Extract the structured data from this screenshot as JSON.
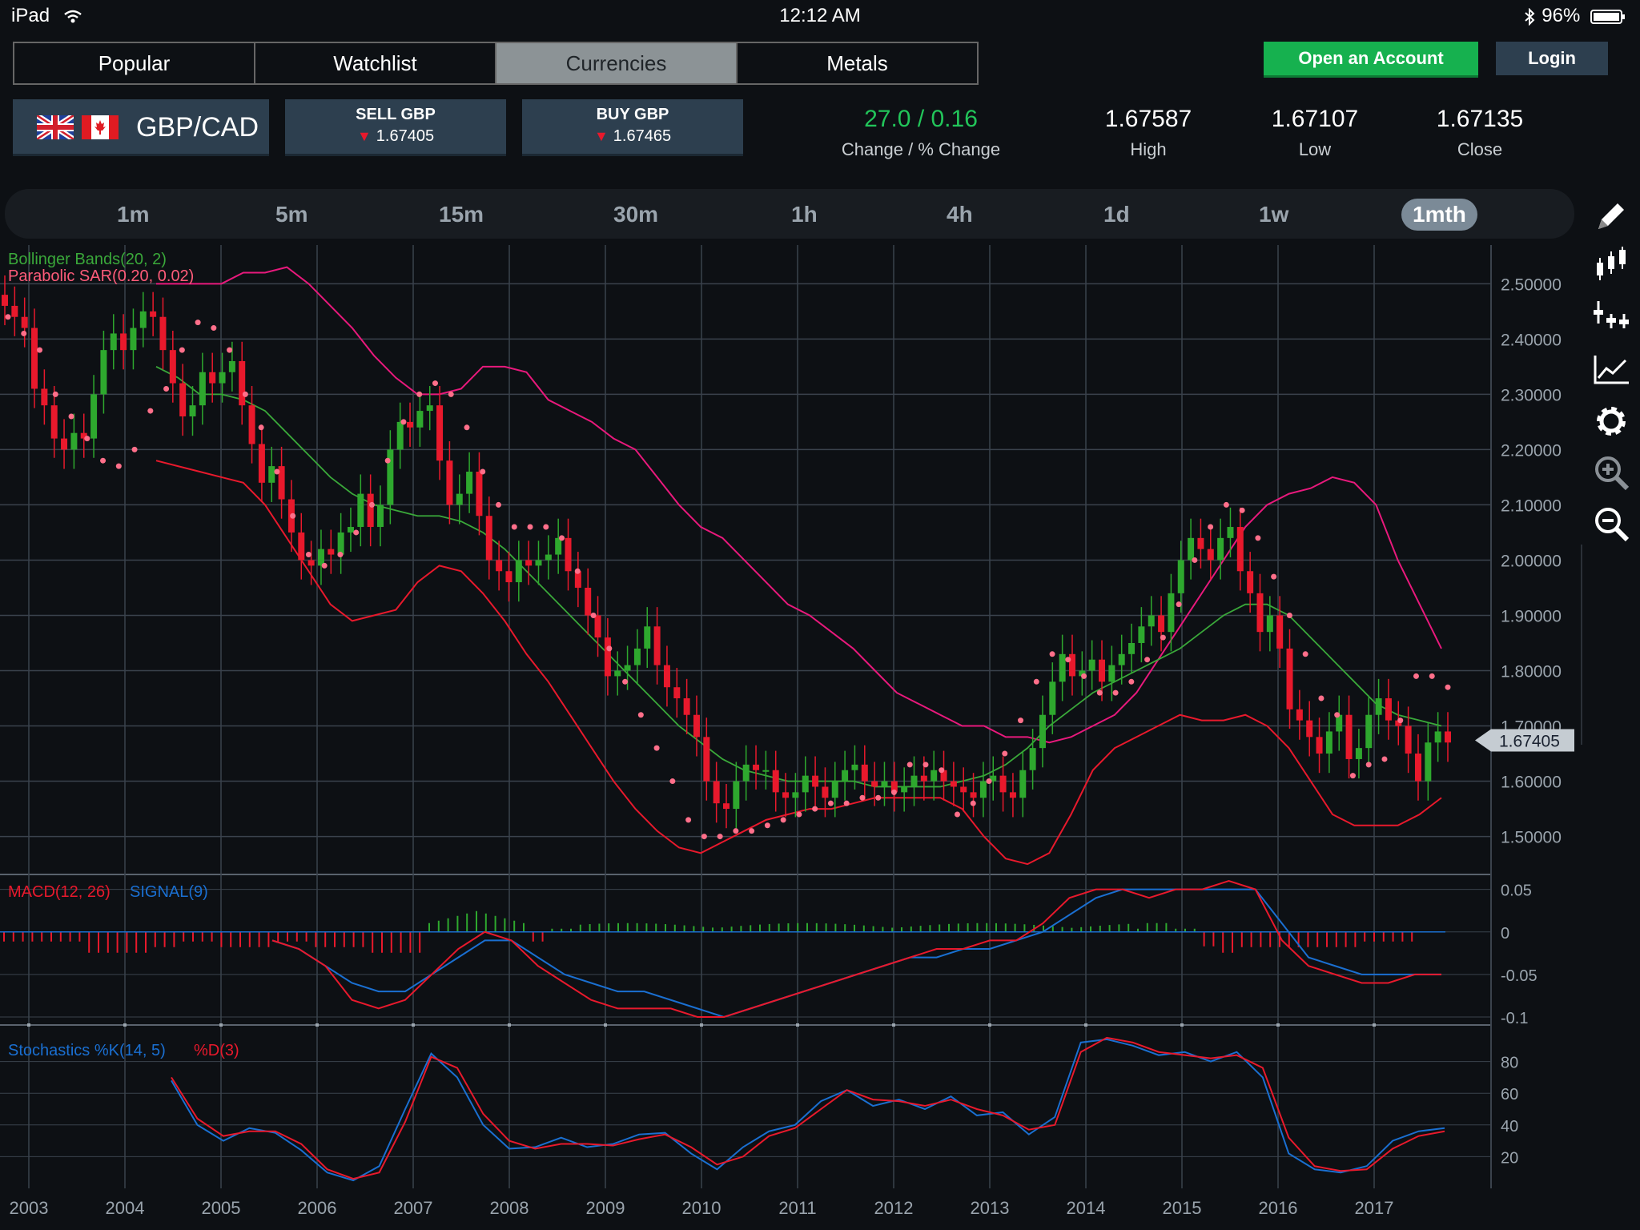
{
  "status_bar": {
    "device": "iPad",
    "time": "12:12 AM",
    "battery": "96%"
  },
  "tabs": [
    {
      "label": "Popular",
      "active": false
    },
    {
      "label": "Watchlist",
      "active": false
    },
    {
      "label": "Currencies",
      "active": true
    },
    {
      "label": "Metals",
      "active": false
    }
  ],
  "buttons": {
    "open_account": "Open an Account",
    "login": "Login"
  },
  "instrument": {
    "pair": "GBP/CAD",
    "flags": [
      "uk-flag-icon",
      "canada-flag-icon"
    ],
    "sell_label": "SELL GBP",
    "sell_price": "1.67405",
    "buy_label": "BUY GBP",
    "buy_price": "1.67465"
  },
  "stats": {
    "change_value": "27.0 / 0.16",
    "change_label": "Change / % Change",
    "high_value": "1.67587",
    "high_label": "High",
    "low_value": "1.67107",
    "low_label": "Low",
    "close_value": "1.67135",
    "close_label": "Close"
  },
  "timeframes": [
    "1m",
    "5m",
    "15m",
    "30m",
    "1h",
    "4h",
    "1d",
    "1w",
    "1mth"
  ],
  "active_timeframe": "1mth",
  "side_tools": [
    "pencil-icon",
    "candlestick-icon",
    "add-indicator-icon",
    "line-chart-icon",
    "gear-icon",
    "zoom-in-icon",
    "zoom-out-icon"
  ],
  "colors": {
    "up": "#2ea82e",
    "down": "#e8192c",
    "bollinger_upper": "#e8197c",
    "bollinger_mid": "#3aa83a",
    "bollinger_lower": "#e8192c",
    "sar": "#ff6f8a",
    "macd": "#e8192c",
    "signal": "#1a6fd1",
    "stoch_k": "#1a6fd1",
    "stoch_d": "#e8192c",
    "grid": "#3a424c",
    "price_tag": "#c5ccd2"
  },
  "chart_data": [
    {
      "type": "candlestick",
      "title": "",
      "indicators": [
        "Bollinger Bands(20, 2)",
        "Parabolic SAR(0.20, 0.02)"
      ],
      "x": [
        "2003",
        "2004",
        "2005",
        "2006",
        "2007",
        "2008",
        "2009",
        "2010",
        "2011",
        "2012",
        "2013",
        "2014",
        "2015",
        "2016",
        "2017"
      ],
      "y_ticks": [
        "2.50000",
        "2.40000",
        "2.30000",
        "2.20000",
        "2.10000",
        "2.00000",
        "1.90000",
        "1.80000",
        "1.70000",
        "1.60000",
        "1.50000"
      ],
      "ylim": [
        1.44,
        2.57
      ],
      "last_price": "1.67405",
      "close": [
        2.46,
        2.44,
        2.42,
        2.31,
        2.28,
        2.22,
        2.2,
        2.23,
        2.22,
        2.3,
        2.38,
        2.41,
        2.38,
        2.42,
        2.45,
        2.44,
        2.38,
        2.32,
        2.26,
        2.28,
        2.34,
        2.32,
        2.34,
        2.36,
        2.28,
        2.21,
        2.14,
        2.17,
        2.11,
        2.05,
        2.0,
        1.99,
        2.02,
        2.01,
        2.05,
        2.06,
        2.12,
        2.06,
        2.1,
        2.2,
        2.25,
        2.24,
        2.27,
        2.28,
        2.18,
        2.1,
        2.12,
        2.16,
        2.08,
        2.0,
        1.98,
        1.96,
        2.0,
        1.99,
        2.0,
        2.01,
        2.04,
        1.98,
        1.95,
        1.9,
        1.86,
        1.79,
        1.8,
        1.81,
        1.84,
        1.88,
        1.81,
        1.77,
        1.75,
        1.72,
        1.68,
        1.6,
        1.56,
        1.55,
        1.6,
        1.63,
        1.62,
        1.62,
        1.58,
        1.57,
        1.58,
        1.61,
        1.59,
        1.57,
        1.6,
        1.62,
        1.63,
        1.6,
        1.59,
        1.6,
        1.58,
        1.59,
        1.61,
        1.6,
        1.62,
        1.6,
        1.59,
        1.58,
        1.57,
        1.6,
        1.61,
        1.58,
        1.57,
        1.62,
        1.66,
        1.72,
        1.78,
        1.83,
        1.79,
        1.8,
        1.82,
        1.78,
        1.81,
        1.83,
        1.85,
        1.88,
        1.9,
        1.87,
        1.94,
        2.0,
        2.04,
        2.02,
        2.0,
        2.04,
        2.06,
        1.98,
        1.94,
        1.87,
        1.9,
        1.84,
        1.73,
        1.71,
        1.68,
        1.65,
        1.69,
        1.72,
        1.64,
        1.66,
        1.72,
        1.75,
        1.71,
        1.7,
        1.65,
        1.6,
        1.67,
        1.69,
        1.67
      ],
      "bollinger_upper": [
        2.5,
        2.5,
        2.5,
        2.5,
        2.52,
        2.52,
        2.53,
        2.5,
        2.46,
        2.42,
        2.37,
        2.33,
        2.3,
        2.3,
        2.31,
        2.35,
        2.35,
        2.34,
        2.29,
        2.27,
        2.25,
        2.22,
        2.2,
        2.15,
        2.1,
        2.06,
        2.04,
        2.0,
        1.96,
        1.92,
        1.9,
        1.87,
        1.84,
        1.8,
        1.76,
        1.74,
        1.72,
        1.7,
        1.7,
        1.68,
        1.68,
        1.67,
        1.68,
        1.7,
        1.72,
        1.76,
        1.82,
        1.88,
        1.94,
        2.0,
        2.06,
        2.1,
        2.12,
        2.13,
        2.15,
        2.14,
        2.1,
        2.0,
        1.92,
        1.84
      ],
      "bollinger_mid": [
        2.35,
        2.33,
        2.3,
        2.3,
        2.29,
        2.27,
        2.23,
        2.19,
        2.15,
        2.12,
        2.1,
        2.09,
        2.08,
        2.08,
        2.07,
        2.05,
        2.02,
        1.98,
        1.94,
        1.9,
        1.86,
        1.82,
        1.78,
        1.74,
        1.7,
        1.67,
        1.64,
        1.62,
        1.61,
        1.6,
        1.6,
        1.6,
        1.6,
        1.59,
        1.59,
        1.59,
        1.59,
        1.6,
        1.61,
        1.63,
        1.66,
        1.7,
        1.73,
        1.76,
        1.78,
        1.8,
        1.82,
        1.84,
        1.87,
        1.9,
        1.92,
        1.92,
        1.9,
        1.86,
        1.82,
        1.78,
        1.74,
        1.72,
        1.71,
        1.7
      ],
      "bollinger_lower": [
        2.18,
        2.17,
        2.16,
        2.15,
        2.14,
        2.1,
        2.04,
        1.98,
        1.92,
        1.89,
        1.9,
        1.91,
        1.96,
        1.99,
        1.98,
        1.94,
        1.89,
        1.83,
        1.78,
        1.72,
        1.66,
        1.6,
        1.55,
        1.51,
        1.48,
        1.47,
        1.49,
        1.51,
        1.53,
        1.54,
        1.55,
        1.55,
        1.56,
        1.57,
        1.57,
        1.57,
        1.57,
        1.55,
        1.5,
        1.46,
        1.45,
        1.47,
        1.54,
        1.62,
        1.66,
        1.68,
        1.7,
        1.72,
        1.71,
        1.71,
        1.72,
        1.7,
        1.66,
        1.6,
        1.54,
        1.52,
        1.52,
        1.52,
        1.54,
        1.57
      ],
      "sar": [
        2.44,
        2.41,
        2.38,
        2.3,
        2.26,
        2.22,
        2.18,
        2.17,
        2.2,
        2.27,
        2.31,
        2.38,
        2.43,
        2.42,
        2.38,
        2.3,
        2.24,
        2.16,
        2.08,
        2.01,
        1.99,
        2.01,
        2.05,
        2.1,
        2.18,
        2.25,
        2.3,
        2.32,
        2.3,
        2.24,
        2.16,
        2.1,
        2.06,
        2.06,
        2.06,
        2.04,
        1.98,
        1.9,
        1.84,
        1.78,
        1.72,
        1.66,
        1.6,
        1.53,
        1.5,
        1.5,
        1.51,
        1.51,
        1.52,
        1.53,
        1.54,
        1.55,
        1.56,
        1.56,
        1.57,
        1.57,
        1.58,
        1.63,
        1.63,
        1.62,
        1.54,
        1.56,
        1.6,
        1.65,
        1.71,
        1.78,
        1.83,
        1.82,
        1.79,
        1.76,
        1.76,
        1.78,
        1.82,
        1.86,
        1.92,
        2.0,
        2.06,
        2.1,
        2.09,
        2.04,
        1.97,
        1.9,
        1.83,
        1.75,
        1.72,
        1.61,
        1.63,
        1.64,
        1.71,
        1.79,
        1.79,
        1.77
      ]
    },
    {
      "type": "line",
      "title": "MACD(12, 26) SIGNAL(9)",
      "series": [
        {
          "name": "MACD(12, 26)"
        },
        {
          "name": "SIGNAL(9)"
        }
      ],
      "y_ticks": [
        "0.05",
        "0",
        "-0.05",
        "-0.1"
      ],
      "ylim": [
        -0.1,
        0.06
      ],
      "macd": [
        -0.01,
        -0.02,
        -0.04,
        -0.08,
        -0.09,
        -0.08,
        -0.05,
        -0.02,
        0.0,
        -0.01,
        -0.04,
        -0.06,
        -0.08,
        -0.09,
        -0.09,
        -0.09,
        -0.1,
        -0.1,
        -0.09,
        -0.08,
        -0.07,
        -0.06,
        -0.05,
        -0.04,
        -0.03,
        -0.02,
        -0.02,
        -0.01,
        -0.01,
        0.01,
        0.04,
        0.05,
        0.05,
        0.04,
        0.05,
        0.05,
        0.06,
        0.05,
        -0.01,
        -0.04,
        -0.05,
        -0.06,
        -0.06,
        -0.05,
        -0.05
      ],
      "signal": [
        -0.01,
        -0.02,
        -0.04,
        -0.06,
        -0.07,
        -0.07,
        -0.05,
        -0.03,
        -0.01,
        -0.01,
        -0.03,
        -0.05,
        -0.06,
        -0.07,
        -0.07,
        -0.08,
        -0.09,
        -0.1,
        -0.09,
        -0.08,
        -0.07,
        -0.06,
        -0.05,
        -0.04,
        -0.03,
        -0.03,
        -0.02,
        -0.02,
        -0.01,
        0.0,
        0.02,
        0.04,
        0.05,
        0.05,
        0.05,
        0.05,
        0.05,
        0.05,
        0.01,
        -0.03,
        -0.04,
        -0.05,
        -0.05,
        -0.05,
        -0.05
      ]
    },
    {
      "type": "line",
      "title": "Stochastics %K(14, 5) %D(3)",
      "series": [
        {
          "name": "%K(14, 5)"
        },
        {
          "name": "%D(3)"
        }
      ],
      "y_ticks": [
        "80",
        "60",
        "40",
        "20"
      ],
      "ylim": [
        0,
        100
      ],
      "k": [
        68,
        40,
        30,
        38,
        35,
        24,
        10,
        5,
        14,
        50,
        85,
        70,
        40,
        25,
        26,
        32,
        26,
        28,
        34,
        35,
        22,
        12,
        26,
        36,
        40,
        55,
        62,
        52,
        56,
        50,
        58,
        46,
        48,
        34,
        45,
        92,
        94,
        90,
        84,
        86,
        80,
        86,
        70,
        22,
        12,
        10,
        14,
        30,
        36,
        38
      ],
      "d": [
        70,
        44,
        33,
        36,
        36,
        28,
        12,
        6,
        10,
        42,
        83,
        76,
        47,
        30,
        25,
        28,
        28,
        27,
        31,
        34,
        26,
        15,
        20,
        33,
        38,
        50,
        62,
        56,
        55,
        52,
        56,
        50,
        46,
        37,
        40,
        86,
        95,
        92,
        86,
        84,
        82,
        84,
        76,
        32,
        14,
        11,
        12,
        25,
        33,
        36
      ]
    }
  ]
}
